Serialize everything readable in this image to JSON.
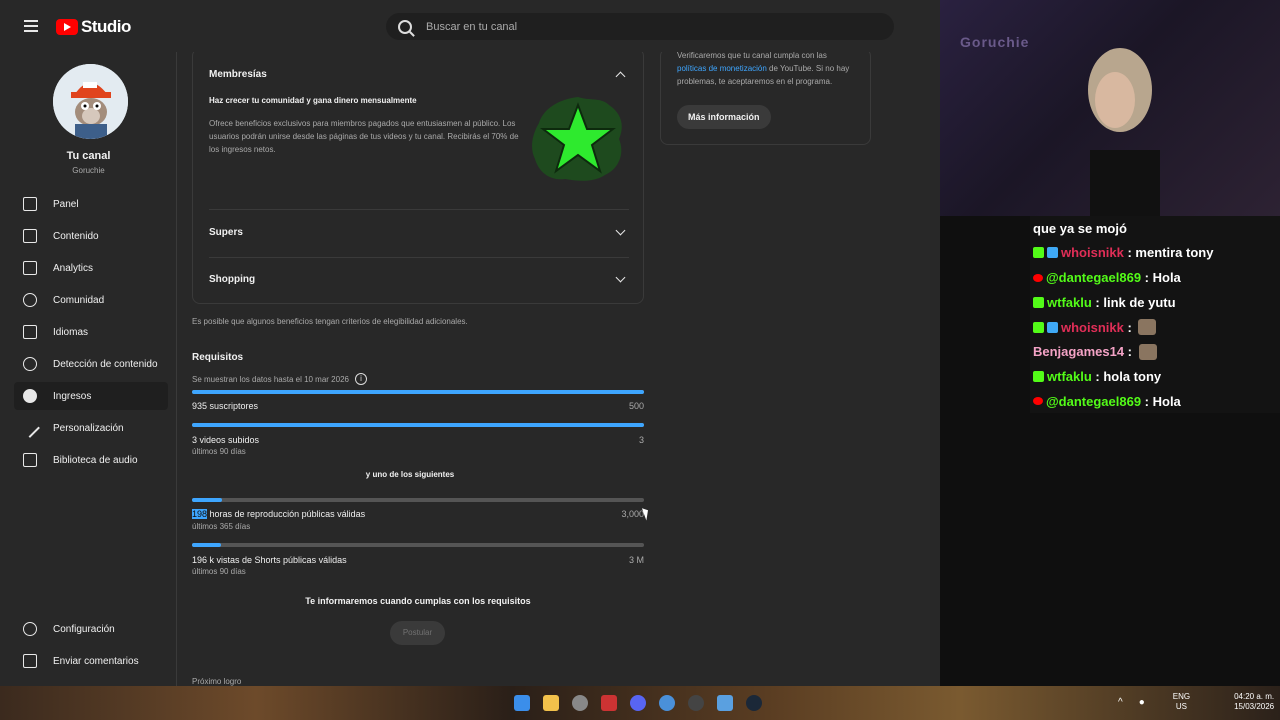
{
  "header": {
    "logo_text": "Studio",
    "search_placeholder": "Buscar en tu canal"
  },
  "sidebar": {
    "channel_title": "Tu canal",
    "channel_handle": "Goruchie",
    "items": [
      {
        "label": "Panel",
        "icon": "dashboard-icon"
      },
      {
        "label": "Contenido",
        "icon": "content-icon"
      },
      {
        "label": "Analytics",
        "icon": "analytics-icon"
      },
      {
        "label": "Comunidad",
        "icon": "community-icon"
      },
      {
        "label": "Idiomas",
        "icon": "subtitles-icon"
      },
      {
        "label": "Detección de contenido",
        "icon": "copyright-icon"
      },
      {
        "label": "Ingresos",
        "icon": "earn-icon",
        "active": true
      },
      {
        "label": "Personalización",
        "icon": "magic-wand-icon"
      },
      {
        "label": "Biblioteca de audio",
        "icon": "audio-library-icon"
      }
    ],
    "bottom": [
      {
        "label": "Configuración",
        "icon": "gear-icon"
      },
      {
        "label": "Enviar comentarios",
        "icon": "feedback-icon"
      }
    ]
  },
  "main": {
    "memberships": {
      "title": "Membresías",
      "subtitle": "Haz crecer tu comunidad y gana dinero mensualmente",
      "description": "Ofrece beneficios exclusivos para miembros pagados que entusiasmen al público. Los usuarios podrán unirse desde las páginas de tus videos y tu canal. Recibirás el 70% de los ingresos netos."
    },
    "supers_title": "Supers",
    "shopping_title": "Shopping",
    "note": "Es posible que algunos beneficios tengan criterios de elegibilidad adicionales.",
    "requirements": {
      "title": "Requisitos",
      "date_note": "Se muestran los datos hasta el 10 mar 2026",
      "subscribers": {
        "label": "935 suscriptores",
        "target": "500",
        "progress": 1.0
      },
      "videos": {
        "label": "3 videos subidos",
        "target": "3",
        "sub": "últimos 90 días",
        "progress": 1.0
      },
      "one_of": "y uno de los siguientes",
      "watch_hours": {
        "highlight": "198",
        "label": " horas de reproducción públicas válidas",
        "target": "3,000",
        "sub": "últimos 365 días",
        "progress": 0.066
      },
      "shorts": {
        "label": "196 k vistas de Shorts públicas válidas",
        "target": "3 M",
        "sub": "últimos 90 días",
        "progress": 0.065
      },
      "notify": "Te informaremos cuando cumplas con los requisitos",
      "apply_button": "Postular",
      "next_label": "Próximo logro"
    },
    "side_card": {
      "text_before": "Verificaremos que tu canal cumpla con las",
      "link": "políticas de monetización",
      "text_after": " de YouTube. Si no hay problemas, te aceptaremos en el programa.",
      "button": "Más información"
    }
  },
  "overlay": {
    "cam_label": "Goruchie"
  },
  "chat": [
    {
      "badges": [],
      "user": "",
      "msg": "que ya se mojó",
      "color": "#ffffff"
    },
    {
      "badges": [
        "kick",
        "prime"
      ],
      "user": "whoisnikk",
      "msg": " : mentira tony",
      "color": "#e02e57"
    },
    {
      "badges": [
        "yt"
      ],
      "user": "@dantegael869",
      "msg": " : Hola",
      "color": "#53fc18"
    },
    {
      "badges": [
        "kick"
      ],
      "user": "wtfaklu",
      "msg": " : link de yutu",
      "color": "#53fc18"
    },
    {
      "badges": [
        "kick",
        "prime"
      ],
      "user": "whoisnikk",
      "msg": " : ",
      "color": "#e02e57",
      "emote": true
    },
    {
      "badges": [],
      "user": "Benjagames14",
      "msg": " : ",
      "color": "#f4a3c6",
      "emote": true
    },
    {
      "badges": [
        "kick"
      ],
      "user": "wtfaklu",
      "msg": " : hola tony",
      "color": "#53fc18"
    },
    {
      "badges": [
        "yt"
      ],
      "user": "@dantegael869",
      "msg": " : Hola",
      "color": "#53fc18"
    }
  ],
  "taskbar": {
    "lang_top": "ENG",
    "lang_bottom": "US",
    "time": "04:20 a. m.",
    "date": "15/03/2026"
  }
}
